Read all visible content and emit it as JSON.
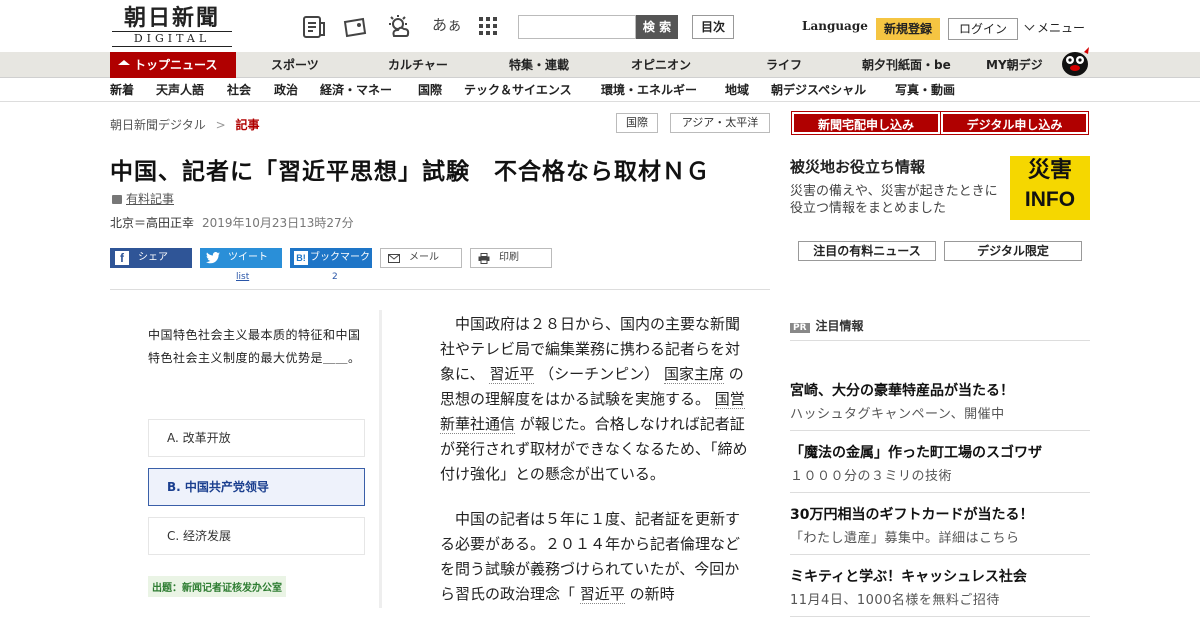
{
  "header": {
    "logo_jp": "朝日新聞",
    "logo_en": "DIGITAL",
    "font_toggle": "あぁ",
    "search_button": "検 索",
    "contents_button": "目次",
    "language": "Language",
    "register": "新規登録",
    "login": "ログイン",
    "menu": "メニュー"
  },
  "nav_main": [
    "トップニュース",
    "スポーツ",
    "カルチャー",
    "特集・連載",
    "オピニオン",
    "ライフ",
    "朝夕刊紙面・be",
    "MY朝デジ"
  ],
  "nav_sub": [
    "新着",
    "天声人語",
    "社会",
    "政治",
    "経済・マネー",
    "国際",
    "テック＆サイエンス",
    "環境・エネルギー",
    "地域",
    "朝デジスペシャル",
    "写真・動画"
  ],
  "breadcrumb": {
    "home": "朝日新聞デジタル",
    "sep": ">",
    "current": "記事"
  },
  "tags": [
    "国際",
    "アジア・太平洋"
  ],
  "subscribe": {
    "paper": "新聞宅配申し込み",
    "digital": "デジタル申し込み"
  },
  "article": {
    "title": "中国、記者に「習近平思想」試験　不合格なら取材ＮＧ",
    "paid_label": "有料記事",
    "author": "北京＝高田正幸",
    "date": "2019年10月23日13時27分",
    "share": {
      "facebook": "シェア",
      "twitter": "ツイート",
      "twitter_count": "list",
      "hatena": "ブックマーク",
      "hatena_count": "2",
      "mail": "メール",
      "print": "印刷"
    },
    "p1": [
      "中国政府は２８日から、国内の主要な新聞社やテレビ局で編集業務に携わる記者らを対象に、",
      "習近平",
      "（シーチンピン）",
      "国家主席",
      "の思想の理解度をはかる試験を実施する。",
      "国営新華社通信",
      "が報じた。合格しなければ記者証が発行されず取材ができなくなるため、「締め付け強化」との懸念が出ている。"
    ],
    "p2": [
      "中国の記者は５年に１度、記者証を更新する必要がある。２０１４年から記者倫理などを問う試験が義務づけられていたが、今回から習氏の政治理念「",
      "習近平",
      "の新時"
    ]
  },
  "quiz": {
    "question": "中国特色社会主义最本质的特征和中国特色社会主义制度的最大优势是＿＿。",
    "options": [
      "A. 改革开放",
      "B. 中国共产党领导",
      "C. 经济发展"
    ],
    "selected": 1,
    "source": "出题：新闻记者证核发办公室"
  },
  "sidebar": {
    "disaster_title": "被災地お役立ち情報",
    "disaster_desc": "災害の備えや、災害が起きたときに役立つ情報をまとめました",
    "disaster_badge_top": "災害",
    "disaster_badge_bottom": "INFO",
    "pill_paid": "注目の有料ニュース",
    "pill_digital": "デジタル限定",
    "pr_badge": "PR",
    "pr_title": "注目情報",
    "pr_items": [
      {
        "title": "宮崎、大分の豪華特産品が当たる！",
        "sub": "ハッシュタグキャンペーン、開催中"
      },
      {
        "title": "「魔法の金属」作った町工場のスゴワザ",
        "sub": "１０００分の３ミリの技術"
      },
      {
        "title": "30万円相当のギフトカードが当たる！",
        "sub": "「わたし遺産」募集中。詳細はこちら"
      },
      {
        "title": "ミキティと学ぶ！キャッシュレス社会",
        "sub": "11月4日、1000名様を無料ご招待"
      }
    ]
  },
  "colors": {
    "brand_red": "#b00000",
    "nav_bg": "#e7e6e1",
    "accent_yellow": "#f5c542",
    "facebook": "#2f5597",
    "twitter": "#2a8fd8",
    "hatena": "#1e75c7"
  }
}
